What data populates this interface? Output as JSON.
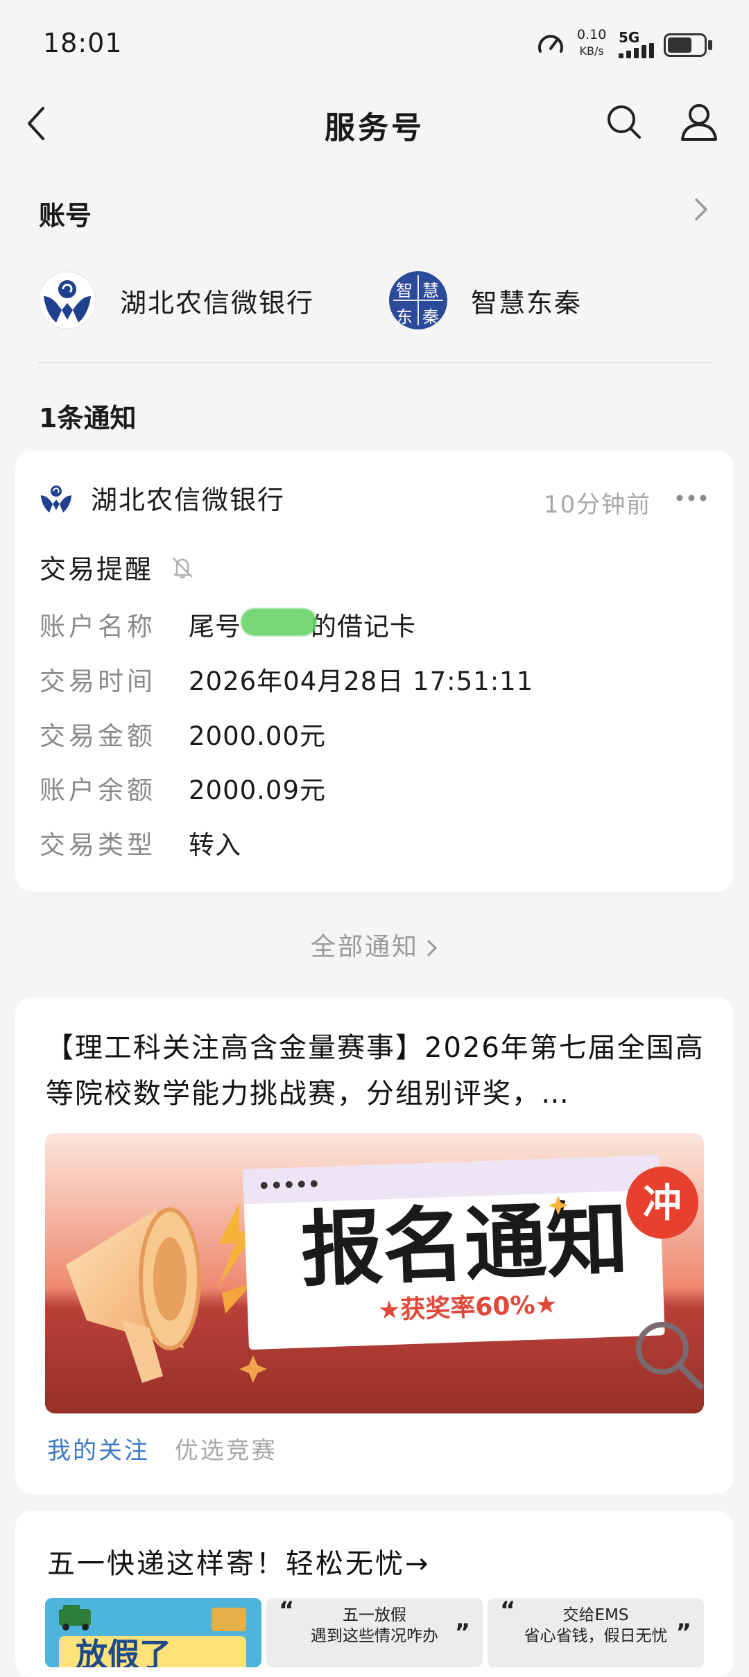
{
  "status_bar": {
    "time": "18:01",
    "speed_value": "0.10",
    "speed_unit": "KB/s",
    "network": "5G"
  },
  "nav": {
    "title": "服务号"
  },
  "accounts": {
    "section_title": "账号",
    "items": [
      {
        "name": "湖北农信微银行",
        "icon": "bank-logo-icon"
      },
      {
        "name": "智慧东秦",
        "icon": "zhihui-dongqin-logo-icon",
        "logo_chars": [
          "智",
          "慧",
          "东",
          "秦"
        ]
      }
    ]
  },
  "notifications": {
    "count_label": "1条通知",
    "card": {
      "sender": "湖北农信微银行",
      "time_ago": "10分钟前",
      "type": "交易提醒",
      "rows": [
        {
          "label": "账户名称",
          "value": "尾号",
          "value_suffix": "的借记卡"
        },
        {
          "label": "交易时间",
          "value": "2026年04月28日 17:51:11"
        },
        {
          "label": "交易金额",
          "value": "2000.00元"
        },
        {
          "label": "账户余额",
          "value": "2000.09元"
        },
        {
          "label": "交易类型",
          "value": "转入"
        }
      ]
    },
    "all_label": "全部通知"
  },
  "articles": [
    {
      "title": "【理工科关注高含金量赛事】2026年第七届全国高等院校数学能力挑战赛，分组别评奖，…",
      "banner": {
        "headline": "报名通知",
        "badge": "冲",
        "subline": "★获奖率60%★"
      },
      "tags": [
        "我的关注",
        "优选竞赛"
      ]
    },
    {
      "title": "五一快递这样寄！轻松无忧→",
      "thumb_text": "放假了",
      "quotes": [
        {
          "line1": "五一放假",
          "line2": "遇到这些情况咋办"
        },
        {
          "line1": "交给EMS",
          "line2": "省心省钱，假日无忧"
        }
      ]
    }
  ],
  "colors": {
    "background": "#f5f5f5",
    "card": "#ffffff",
    "tag_blue": "#3c78c8",
    "muted_text": "#8a8a8a",
    "bank_blue": "#1f3f8f",
    "banner_red": "#d8503a"
  }
}
